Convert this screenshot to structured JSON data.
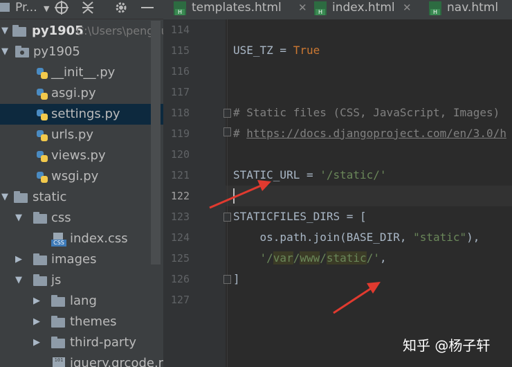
{
  "project_panel": {
    "title": "Pr...",
    "tree": [
      {
        "label": "py1905",
        "path": "C:\\Users\\penghu",
        "kind": "root-folder"
      },
      {
        "label": "py1905",
        "kind": "package"
      },
      {
        "label": "__init__.py",
        "kind": "python"
      },
      {
        "label": "asgi.py",
        "kind": "python"
      },
      {
        "label": "settings.py",
        "kind": "python",
        "selected": true
      },
      {
        "label": "urls.py",
        "kind": "python"
      },
      {
        "label": "views.py",
        "kind": "python"
      },
      {
        "label": "wsgi.py",
        "kind": "python"
      },
      {
        "label": "static",
        "kind": "folder"
      },
      {
        "label": "css",
        "kind": "folder"
      },
      {
        "label": "index.css",
        "kind": "css"
      },
      {
        "label": "images",
        "kind": "folder"
      },
      {
        "label": "js",
        "kind": "folder"
      },
      {
        "label": "lang",
        "kind": "folder"
      },
      {
        "label": "themes",
        "kind": "folder"
      },
      {
        "label": "third-party",
        "kind": "folder"
      },
      {
        "label": "jquery.qrcode.m",
        "kind": "file"
      }
    ]
  },
  "tabs": [
    {
      "label": "templates.html"
    },
    {
      "label": "index.html"
    },
    {
      "label": "nav.html"
    }
  ],
  "file_icon_text": {
    "html": "H",
    "css": "CSS",
    "file": "101"
  },
  "editor": {
    "line_numbers": [
      "114",
      "115",
      "116",
      "117",
      "118",
      "119",
      "120",
      "121",
      "122",
      "123",
      "124",
      "125",
      "126",
      "127"
    ],
    "current_line": "122",
    "code": {
      "l115_name": "USE_TZ = ",
      "l115_value": "True",
      "l118": "# Static files (CSS, JavaScript, Images)",
      "l119_hash": "# ",
      "l119_link": "https://docs.djangoproject.com/en/3.0/h",
      "l121_name": "STATIC_URL = ",
      "l121_value": "'/static/'",
      "l123": "STATICFILES_DIRS = [",
      "l124_a": "    os.path.join(BASE_DIR, ",
      "l124_str": "\"static\"",
      "l124_b": "),",
      "l125_q1": "'/",
      "l125_var": "var",
      "l125_s1": "/",
      "l125_www": "www",
      "l125_s2": "/",
      "l125_static": "static",
      "l125_q2": "/'",
      "l125_comma": ",",
      "l126": "]"
    }
  },
  "watermark": "知乎 @杨子轩",
  "colors": {
    "accent_arrow": "#e03a2f",
    "selection": "#0d293e",
    "string": "#6a8759",
    "keyword": "#cc7832"
  }
}
